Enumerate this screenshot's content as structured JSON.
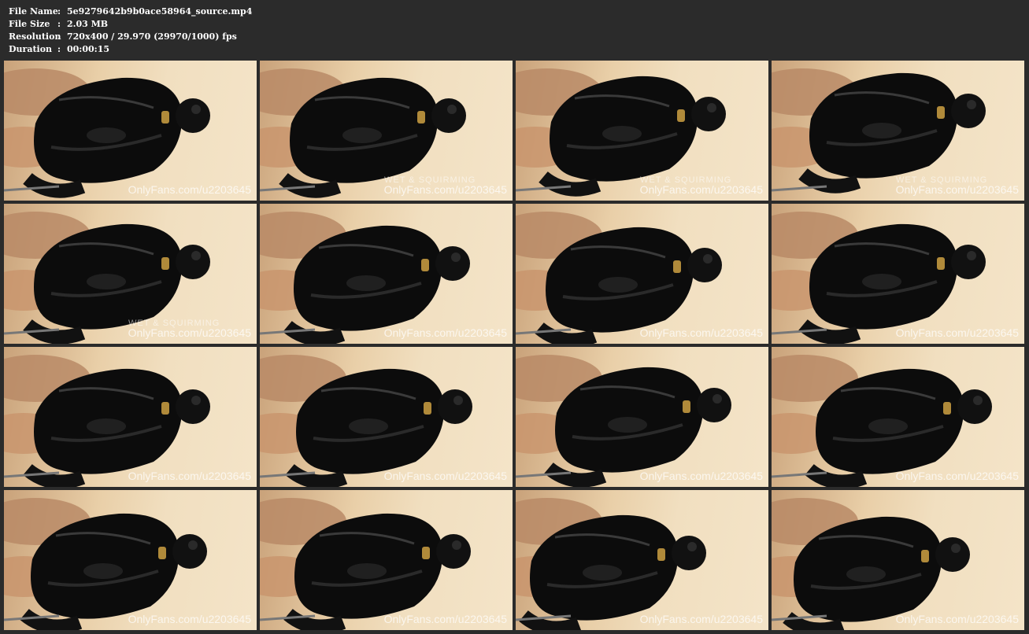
{
  "meta": {
    "rows": [
      {
        "key": "File Name",
        "value": "5e9279642b9b0ace58964_source.mp4"
      },
      {
        "key": "File Size",
        "value": "2.03 MB"
      },
      {
        "key": "Resolution",
        "value": "720x400 / 29.970 (29970/1000) fps"
      },
      {
        "key": "Duration",
        "value": "00:00:15"
      }
    ],
    "separator": ":"
  },
  "thumbnails": [
    {
      "watermark": "OnlyFans.com/u2203645",
      "caption": ""
    },
    {
      "watermark": "OnlyFans.com/u2203645",
      "caption": "WET & SQUIRMING"
    },
    {
      "watermark": "OnlyFans.com/u2203645",
      "caption": "WET & SQUIRMING"
    },
    {
      "watermark": "OnlyFans.com/u2203645",
      "caption": "WET & SQUIRMING"
    },
    {
      "watermark": "OnlyFans.com/u2203645",
      "caption": "WET & SQUIRMING"
    },
    {
      "watermark": "OnlyFans.com/u2203645",
      "caption": ""
    },
    {
      "watermark": "OnlyFans.com/u2203645",
      "caption": ""
    },
    {
      "watermark": "OnlyFans.com/u2203645",
      "caption": ""
    },
    {
      "watermark": "OnlyFans.com/u2203645",
      "caption": ""
    },
    {
      "watermark": "OnlyFans.com/u2203645",
      "caption": ""
    },
    {
      "watermark": "OnlyFans.com/u2203645",
      "caption": ""
    },
    {
      "watermark": "OnlyFans.com/u2203645",
      "caption": ""
    },
    {
      "watermark": "OnlyFans.com/u2203645",
      "caption": ""
    },
    {
      "watermark": "OnlyFans.com/u2203645",
      "caption": ""
    },
    {
      "watermark": "OnlyFans.com/u2203645",
      "caption": ""
    },
    {
      "watermark": "OnlyFans.com/u2203645",
      "caption": ""
    }
  ],
  "colors": {
    "background": "#2b2b2b",
    "text": "#ffffff"
  }
}
